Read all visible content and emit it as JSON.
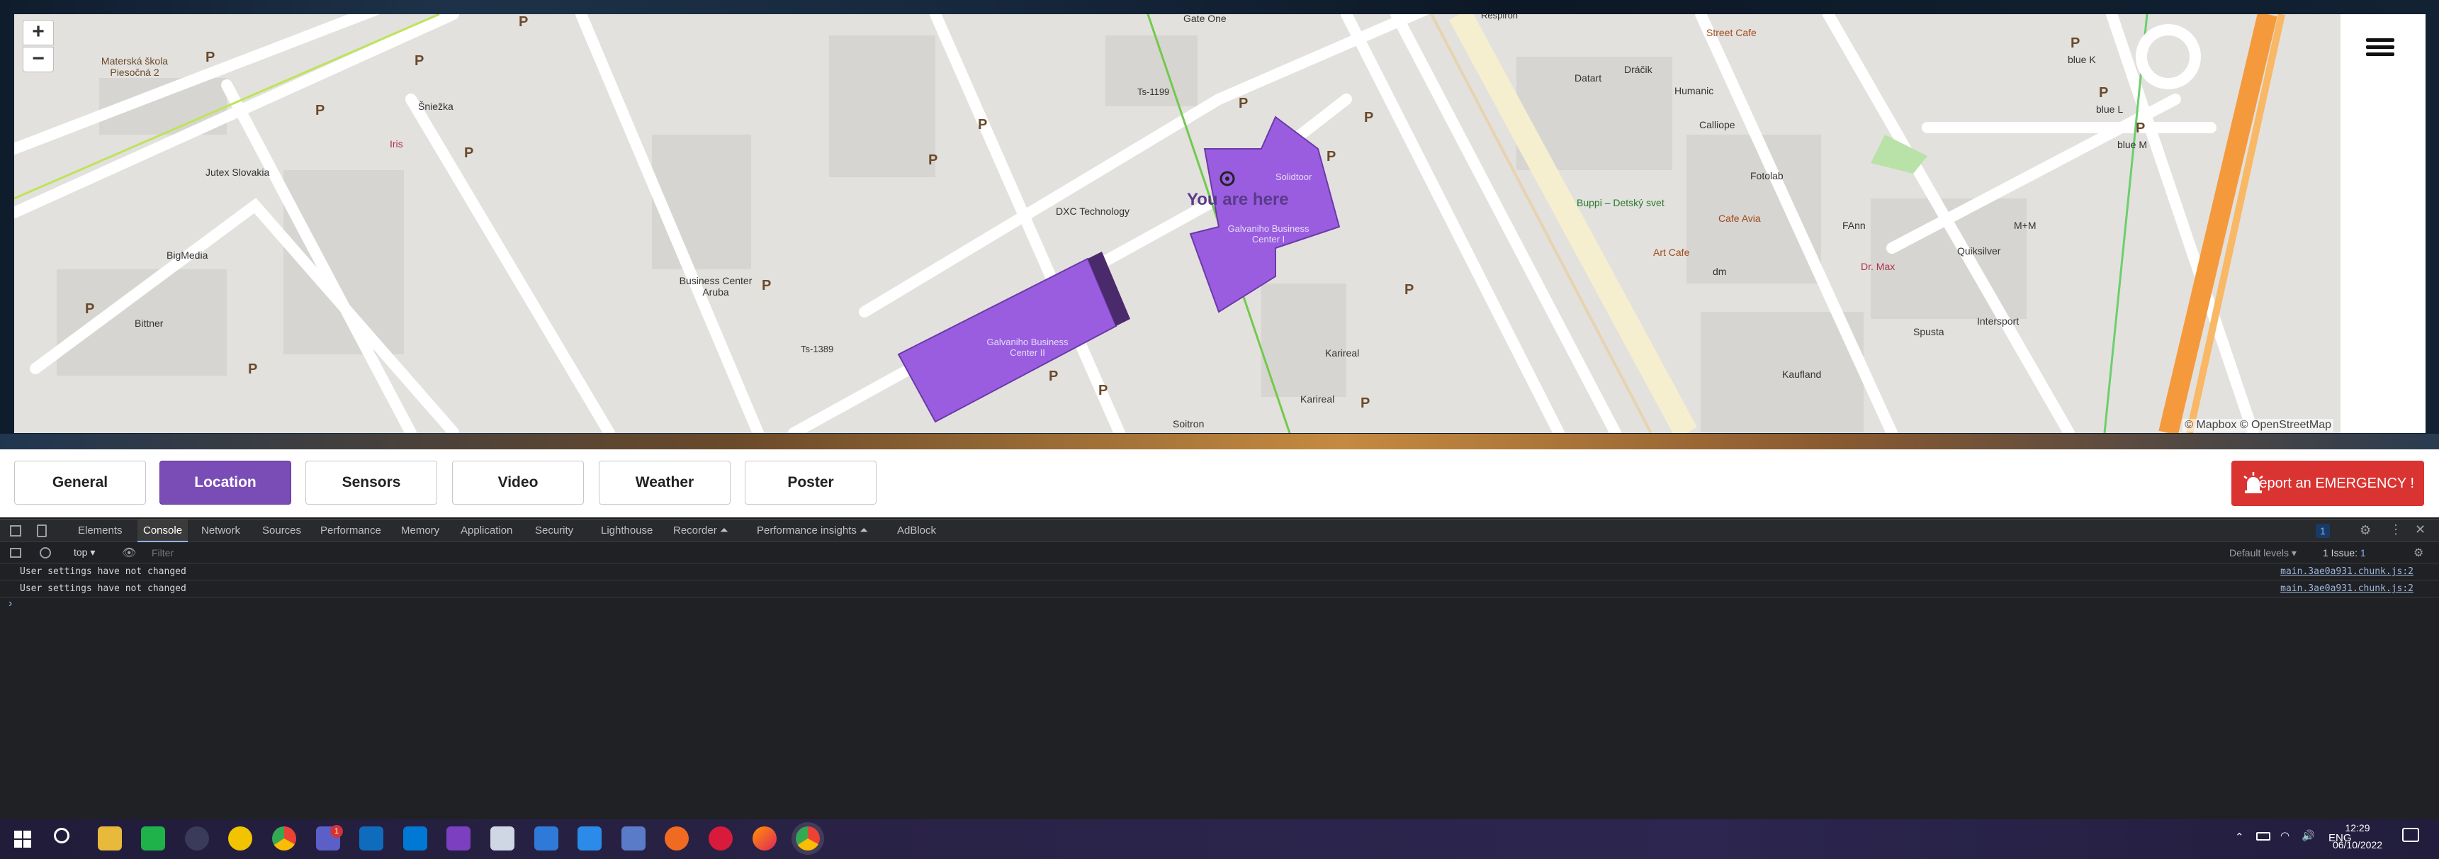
{
  "map": {
    "zoom_in": "+",
    "zoom_out": "−",
    "attribution": "© Mapbox © OpenStreetMap",
    "you_are_here": "You are here",
    "labels": {
      "materska": "Materská škola Piesočná 2",
      "sniezka": "Šniežka",
      "iris": "Iris",
      "jutex": "Jutex Slovakia",
      "bigmedia": "BigMedia",
      "bittner": "Bittner",
      "aruba": "Business Center Aruba",
      "ts1389": "Ts-1389",
      "ts1199": "Ts-1199",
      "gateone": "Gate One",
      "dxc": "DXC Technology",
      "solidtoor": "Solidtoor",
      "galvaniho1": "Galvaniho Business Center I",
      "galvaniho2": "Galvaniho Business Center II",
      "karireal1": "Karireal",
      "karireal2": "Karireal",
      "soitron": "Soitron",
      "respiron": "Respiron",
      "streetcafe": "Street Cafe",
      "datart": "Datart",
      "dracik": "Dráčik",
      "humanic": "Humanic",
      "calliope": "Calliope",
      "buppi": "Buppi – Detský svet",
      "fotolab": "Fotolab",
      "cafeavia": "Cafe Avia",
      "artcafe": "Art Cafe",
      "dm": "dm",
      "fann": "FAnn",
      "drmax": "Dr. Max",
      "quiksilver": "Quiksilver",
      "mm": "M+M",
      "intersport": "Intersport",
      "spusta": "Spusta",
      "kaufland": "Kaufland",
      "bluek": "blue K",
      "bluel": "blue L",
      "bluem": "blue M",
      "parking": "P"
    }
  },
  "tabs": [
    {
      "label": "General"
    },
    {
      "label": "Location"
    },
    {
      "label": "Sensors"
    },
    {
      "label": "Video"
    },
    {
      "label": "Weather"
    },
    {
      "label": "Poster"
    }
  ],
  "active_tab": "Location",
  "emergency_button": "Report an EMERGENCY !",
  "devtools": {
    "tabs": [
      "Elements",
      "Console",
      "Network",
      "Sources",
      "Performance",
      "Memory",
      "Application",
      "Security",
      "Lighthouse",
      "Recorder ⏶",
      "Performance insights ⏶",
      "AdBlock"
    ],
    "active": "Console",
    "issues_badge": "1",
    "context": "top",
    "filter_placeholder": "Filter",
    "default_levels": "Default levels ▾",
    "issue_label": "1 Issue: ",
    "issue_count": "1",
    "messages": [
      {
        "text": "User settings have not changed",
        "source": "main.3ae0a931.chunk.js:2"
      },
      {
        "text": "User settings have not changed",
        "source": "main.3ae0a931.chunk.js:2"
      }
    ],
    "prompt": "›"
  },
  "taskbar": {
    "lang": "ENG",
    "time": "12:29",
    "date": "06/10/2022",
    "mail_badge": "1"
  },
  "colors": {
    "accent": "#7a4cb5",
    "emergency": "#d93431",
    "building": "#9a5de0",
    "devtools_bg": "#202124"
  }
}
